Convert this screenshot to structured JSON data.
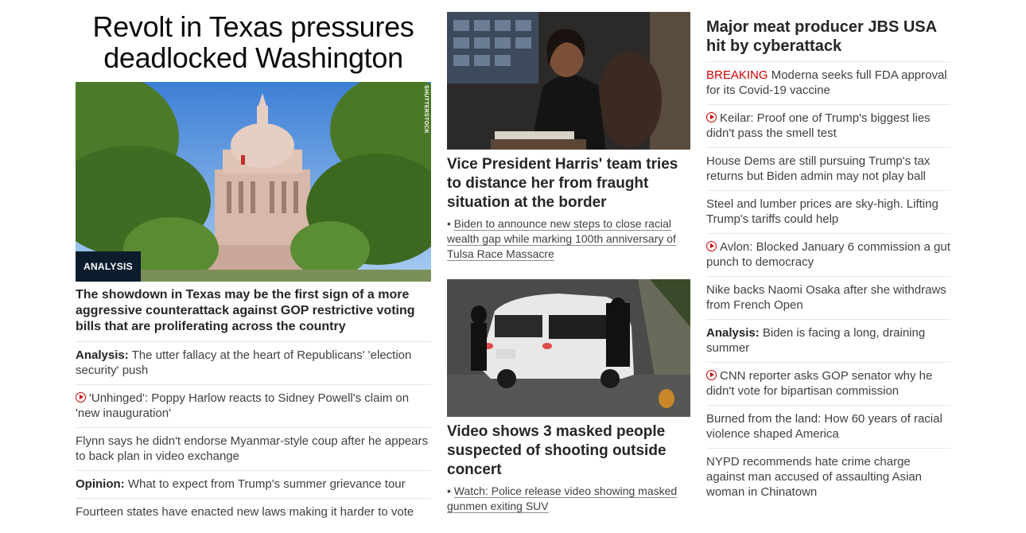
{
  "left": {
    "banner_headline": "Revolt in Texas pressures deadlocked Washington",
    "hero_badge": "ANALYSIS",
    "hero_credit": "SHUTTERSTOCK",
    "hero_headline": "The showdown in Texas may be the first sign of a more aggressive counterattack against GOP restrictive voting bills that are proliferating across the country",
    "items": [
      {
        "prefix": "Analysis:",
        "text": " The utter fallacy at the heart of Republicans' 'election security' push",
        "video": false
      },
      {
        "prefix": "",
        "text": "'Unhinged': Poppy Harlow reacts to Sidney Powell's claim on 'new inauguration'",
        "video": true
      },
      {
        "prefix": "",
        "text": "Flynn says he didn't endorse Myanmar-style coup after he appears to back plan in video exchange",
        "video": false
      },
      {
        "prefix": "Opinion:",
        "text": " What to expect from Trump's summer grievance tour",
        "video": false
      },
      {
        "prefix": "",
        "text": "Fourteen states have enacted new laws making it harder to vote",
        "video": false
      }
    ]
  },
  "middle": {
    "story1": {
      "headline": "Vice President Harris' team tries to distance her from fraught situation at the border",
      "sub": "Biden to announce new steps to close racial wealth gap while marking 100th anniversary of Tulsa Race Massacre"
    },
    "story2": {
      "headline": "Video shows 3 masked people suspected of shooting outside concert",
      "sub": "Watch: Police release video showing masked gunmen exiting SUV"
    },
    "bullet": "•"
  },
  "right": {
    "title": "Major meat producer JBS USA hit by cyberattack",
    "items": [
      {
        "breaking": "BREAKING",
        "prefix": "",
        "text": " Moderna seeks full FDA approval for its Covid-19 vaccine",
        "video": false
      },
      {
        "breaking": "",
        "prefix": "",
        "text": "Keilar: Proof one of Trump's biggest lies didn't pass the smell test",
        "video": true
      },
      {
        "breaking": "",
        "prefix": "",
        "text": "House Dems are still pursuing Trump's tax returns but Biden admin may not play ball",
        "video": false
      },
      {
        "breaking": "",
        "prefix": "",
        "text": "Steel and lumber prices are sky-high. Lifting Trump's tariffs could help",
        "video": false
      },
      {
        "breaking": "",
        "prefix": "",
        "text": "Avlon: Blocked January 6 commission a gut punch to democracy",
        "video": true
      },
      {
        "breaking": "",
        "prefix": "",
        "text": "Nike backs Naomi Osaka after she withdraws from French Open",
        "video": false
      },
      {
        "breaking": "",
        "prefix": "Analysis:",
        "text": " Biden is facing a long, draining summer",
        "video": false
      },
      {
        "breaking": "",
        "prefix": "",
        "text": "CNN reporter asks GOP senator why he didn't vote for bipartisan commission",
        "video": true
      },
      {
        "breaking": "",
        "prefix": "",
        "text": "Burned from the land: How 60 years of racial violence shaped America",
        "video": false
      },
      {
        "breaking": "",
        "prefix": "",
        "text": "NYPD recommends hate crime charge against man accused of assaulting Asian woman in Chinatown",
        "video": false
      }
    ]
  },
  "colors": {
    "breaking": "#cc0000",
    "badge_bg": "#0c1c2c",
    "divider": "#e6e6e6",
    "text": "#262626"
  }
}
